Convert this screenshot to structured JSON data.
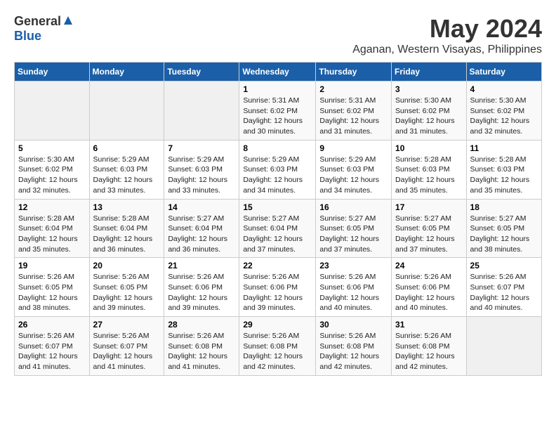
{
  "header": {
    "logo_general": "General",
    "logo_blue": "Blue",
    "month": "May 2024",
    "location": "Aganan, Western Visayas, Philippines"
  },
  "days_of_week": [
    "Sunday",
    "Monday",
    "Tuesday",
    "Wednesday",
    "Thursday",
    "Friday",
    "Saturday"
  ],
  "weeks": [
    [
      {
        "day": "",
        "sunrise": "",
        "sunset": "",
        "daylight": ""
      },
      {
        "day": "",
        "sunrise": "",
        "sunset": "",
        "daylight": ""
      },
      {
        "day": "",
        "sunrise": "",
        "sunset": "",
        "daylight": ""
      },
      {
        "day": "1",
        "sunrise": "Sunrise: 5:31 AM",
        "sunset": "Sunset: 6:02 PM",
        "daylight": "Daylight: 12 hours and 30 minutes."
      },
      {
        "day": "2",
        "sunrise": "Sunrise: 5:31 AM",
        "sunset": "Sunset: 6:02 PM",
        "daylight": "Daylight: 12 hours and 31 minutes."
      },
      {
        "day": "3",
        "sunrise": "Sunrise: 5:30 AM",
        "sunset": "Sunset: 6:02 PM",
        "daylight": "Daylight: 12 hours and 31 minutes."
      },
      {
        "day": "4",
        "sunrise": "Sunrise: 5:30 AM",
        "sunset": "Sunset: 6:02 PM",
        "daylight": "Daylight: 12 hours and 32 minutes."
      }
    ],
    [
      {
        "day": "5",
        "sunrise": "Sunrise: 5:30 AM",
        "sunset": "Sunset: 6:02 PM",
        "daylight": "Daylight: 12 hours and 32 minutes."
      },
      {
        "day": "6",
        "sunrise": "Sunrise: 5:29 AM",
        "sunset": "Sunset: 6:03 PM",
        "daylight": "Daylight: 12 hours and 33 minutes."
      },
      {
        "day": "7",
        "sunrise": "Sunrise: 5:29 AM",
        "sunset": "Sunset: 6:03 PM",
        "daylight": "Daylight: 12 hours and 33 minutes."
      },
      {
        "day": "8",
        "sunrise": "Sunrise: 5:29 AM",
        "sunset": "Sunset: 6:03 PM",
        "daylight": "Daylight: 12 hours and 34 minutes."
      },
      {
        "day": "9",
        "sunrise": "Sunrise: 5:29 AM",
        "sunset": "Sunset: 6:03 PM",
        "daylight": "Daylight: 12 hours and 34 minutes."
      },
      {
        "day": "10",
        "sunrise": "Sunrise: 5:28 AM",
        "sunset": "Sunset: 6:03 PM",
        "daylight": "Daylight: 12 hours and 35 minutes."
      },
      {
        "day": "11",
        "sunrise": "Sunrise: 5:28 AM",
        "sunset": "Sunset: 6:03 PM",
        "daylight": "Daylight: 12 hours and 35 minutes."
      }
    ],
    [
      {
        "day": "12",
        "sunrise": "Sunrise: 5:28 AM",
        "sunset": "Sunset: 6:04 PM",
        "daylight": "Daylight: 12 hours and 35 minutes."
      },
      {
        "day": "13",
        "sunrise": "Sunrise: 5:28 AM",
        "sunset": "Sunset: 6:04 PM",
        "daylight": "Daylight: 12 hours and 36 minutes."
      },
      {
        "day": "14",
        "sunrise": "Sunrise: 5:27 AM",
        "sunset": "Sunset: 6:04 PM",
        "daylight": "Daylight: 12 hours and 36 minutes."
      },
      {
        "day": "15",
        "sunrise": "Sunrise: 5:27 AM",
        "sunset": "Sunset: 6:04 PM",
        "daylight": "Daylight: 12 hours and 37 minutes."
      },
      {
        "day": "16",
        "sunrise": "Sunrise: 5:27 AM",
        "sunset": "Sunset: 6:05 PM",
        "daylight": "Daylight: 12 hours and 37 minutes."
      },
      {
        "day": "17",
        "sunrise": "Sunrise: 5:27 AM",
        "sunset": "Sunset: 6:05 PM",
        "daylight": "Daylight: 12 hours and 37 minutes."
      },
      {
        "day": "18",
        "sunrise": "Sunrise: 5:27 AM",
        "sunset": "Sunset: 6:05 PM",
        "daylight": "Daylight: 12 hours and 38 minutes."
      }
    ],
    [
      {
        "day": "19",
        "sunrise": "Sunrise: 5:26 AM",
        "sunset": "Sunset: 6:05 PM",
        "daylight": "Daylight: 12 hours and 38 minutes."
      },
      {
        "day": "20",
        "sunrise": "Sunrise: 5:26 AM",
        "sunset": "Sunset: 6:05 PM",
        "daylight": "Daylight: 12 hours and 39 minutes."
      },
      {
        "day": "21",
        "sunrise": "Sunrise: 5:26 AM",
        "sunset": "Sunset: 6:06 PM",
        "daylight": "Daylight: 12 hours and 39 minutes."
      },
      {
        "day": "22",
        "sunrise": "Sunrise: 5:26 AM",
        "sunset": "Sunset: 6:06 PM",
        "daylight": "Daylight: 12 hours and 39 minutes."
      },
      {
        "day": "23",
        "sunrise": "Sunrise: 5:26 AM",
        "sunset": "Sunset: 6:06 PM",
        "daylight": "Daylight: 12 hours and 40 minutes."
      },
      {
        "day": "24",
        "sunrise": "Sunrise: 5:26 AM",
        "sunset": "Sunset: 6:06 PM",
        "daylight": "Daylight: 12 hours and 40 minutes."
      },
      {
        "day": "25",
        "sunrise": "Sunrise: 5:26 AM",
        "sunset": "Sunset: 6:07 PM",
        "daylight": "Daylight: 12 hours and 40 minutes."
      }
    ],
    [
      {
        "day": "26",
        "sunrise": "Sunrise: 5:26 AM",
        "sunset": "Sunset: 6:07 PM",
        "daylight": "Daylight: 12 hours and 41 minutes."
      },
      {
        "day": "27",
        "sunrise": "Sunrise: 5:26 AM",
        "sunset": "Sunset: 6:07 PM",
        "daylight": "Daylight: 12 hours and 41 minutes."
      },
      {
        "day": "28",
        "sunrise": "Sunrise: 5:26 AM",
        "sunset": "Sunset: 6:08 PM",
        "daylight": "Daylight: 12 hours and 41 minutes."
      },
      {
        "day": "29",
        "sunrise": "Sunrise: 5:26 AM",
        "sunset": "Sunset: 6:08 PM",
        "daylight": "Daylight: 12 hours and 42 minutes."
      },
      {
        "day": "30",
        "sunrise": "Sunrise: 5:26 AM",
        "sunset": "Sunset: 6:08 PM",
        "daylight": "Daylight: 12 hours and 42 minutes."
      },
      {
        "day": "31",
        "sunrise": "Sunrise: 5:26 AM",
        "sunset": "Sunset: 6:08 PM",
        "daylight": "Daylight: 12 hours and 42 minutes."
      },
      {
        "day": "",
        "sunrise": "",
        "sunset": "",
        "daylight": ""
      }
    ]
  ]
}
